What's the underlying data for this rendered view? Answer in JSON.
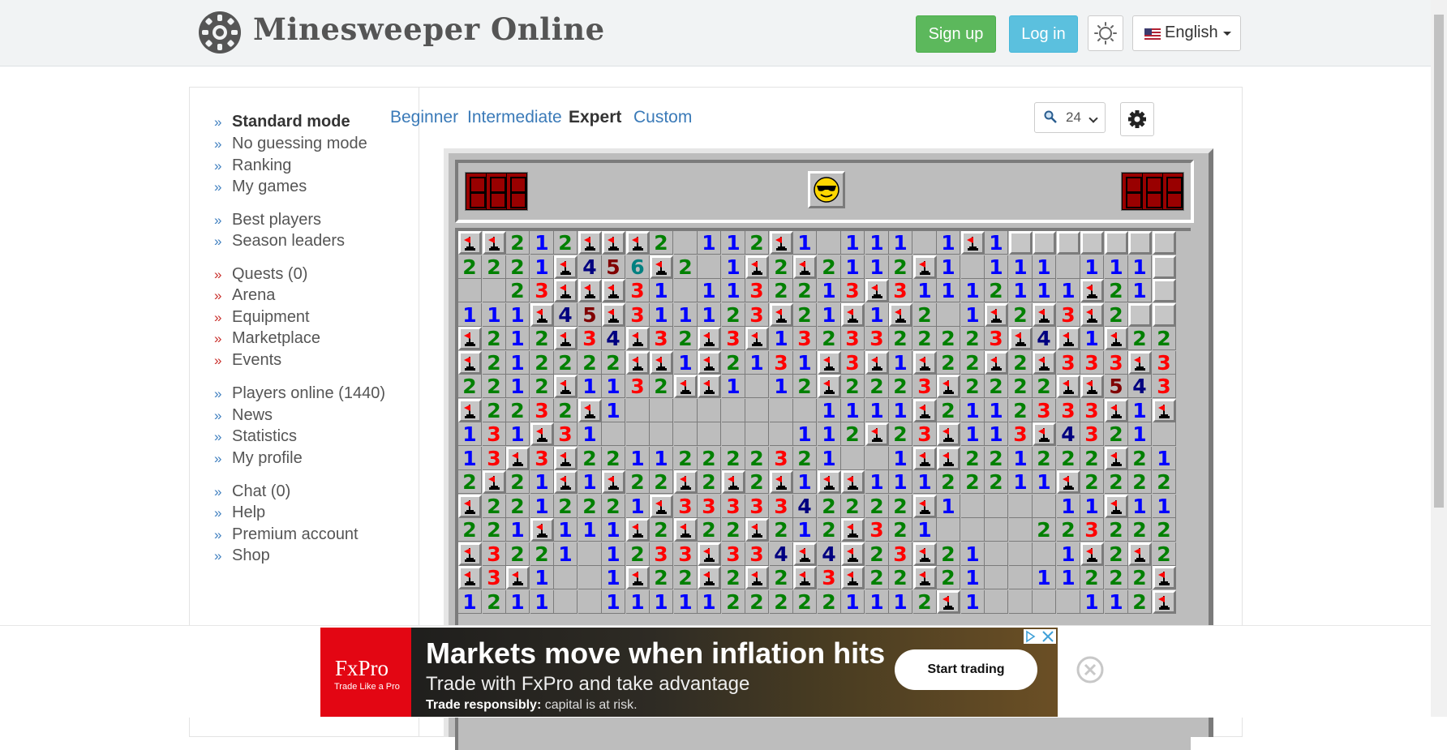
{
  "header": {
    "site_title": "Minesweeper Online",
    "signup_label": "Sign up",
    "login_label": "Log in",
    "language_label": "English"
  },
  "sidebar": {
    "items": [
      {
        "label": "Standard mode",
        "active": true,
        "accent": "blue"
      },
      {
        "label": "No guessing mode",
        "accent": "blue"
      },
      {
        "label": "Ranking",
        "accent": "blue"
      },
      {
        "label": "My games",
        "accent": "blue"
      },
      {
        "label": "Best players",
        "accent": "blue"
      },
      {
        "label": "Season leaders",
        "accent": "blue"
      },
      {
        "label": "Quests (0)",
        "accent": "red"
      },
      {
        "label": "Arena",
        "accent": "red"
      },
      {
        "label": "Equipment",
        "accent": "red"
      },
      {
        "label": "Marketplace",
        "accent": "red"
      },
      {
        "label": "Events",
        "accent": "red"
      },
      {
        "label": "Players online (1440)",
        "accent": "blue"
      },
      {
        "label": "News",
        "accent": "blue"
      },
      {
        "label": "Statistics",
        "accent": "blue"
      },
      {
        "label": "My profile",
        "accent": "blue"
      },
      {
        "label": "Chat (0)",
        "accent": "blue"
      },
      {
        "label": "Help",
        "accent": "blue"
      },
      {
        "label": "Premium account",
        "accent": "blue"
      },
      {
        "label": "Shop",
        "accent": "blue"
      }
    ]
  },
  "level_tabs": [
    {
      "label": "Beginner"
    },
    {
      "label": "Intermediate"
    },
    {
      "label": "Expert",
      "active": true
    },
    {
      "label": "Custom"
    }
  ],
  "zoom": {
    "value": "24"
  },
  "game": {
    "mines_counter": "000",
    "timer_counter": "000",
    "face": "sunglasses",
    "board_legend": "Board rows: digit = revealed number, F = flag, . = revealed empty, # = unrevealed",
    "board": [
      "FF212FFF2.112F1.111.1F1#####",
      "2221F456F2.1F2F2112F1.111.111",
      "..23FFF31.1132213F31112111F21",
      "111F45F311123F21F1F2.1F2F3F2",
      "F212F34F32F3F1323322223F4F1F222",
      "F212222FF1F2131F3F1F22F2F333F31F2F2",
      "2212F1132FF1.12F2223F2222FF54313F2",
      "F2232F1........1111F2112333F1F3F1321",
      "131F31........112F23F113F4321.1",
      "13F3F22112222321..1FF221222F211",
      "2F21F1F22F2F2F1FF11122211F22221",
      "F2212221F3333342222F1....11F1111F1",
      "221F111F2F22F212F321....2232221",
      "F3221.1233F334F4F23F21...1F2F22F",
      "F3F1..1F22F2F2F3F22F21..11222F32",
      "1211..11111222221112F1....112F"
    ]
  },
  "ad": {
    "brand": "FxPro",
    "brand_tagline": "Trade Like a Pro",
    "headline": "Markets move when inflation hits",
    "subline": "Trade with FxPro and take advantage",
    "risk_label": "Trade responsibly:",
    "risk_text": " capital is at risk.",
    "cta": "Start trading"
  },
  "colors": {
    "signup": "#5cb85c",
    "login": "#5bc0de",
    "link": "#3a7ab8",
    "ad_brand": "#e30613"
  }
}
